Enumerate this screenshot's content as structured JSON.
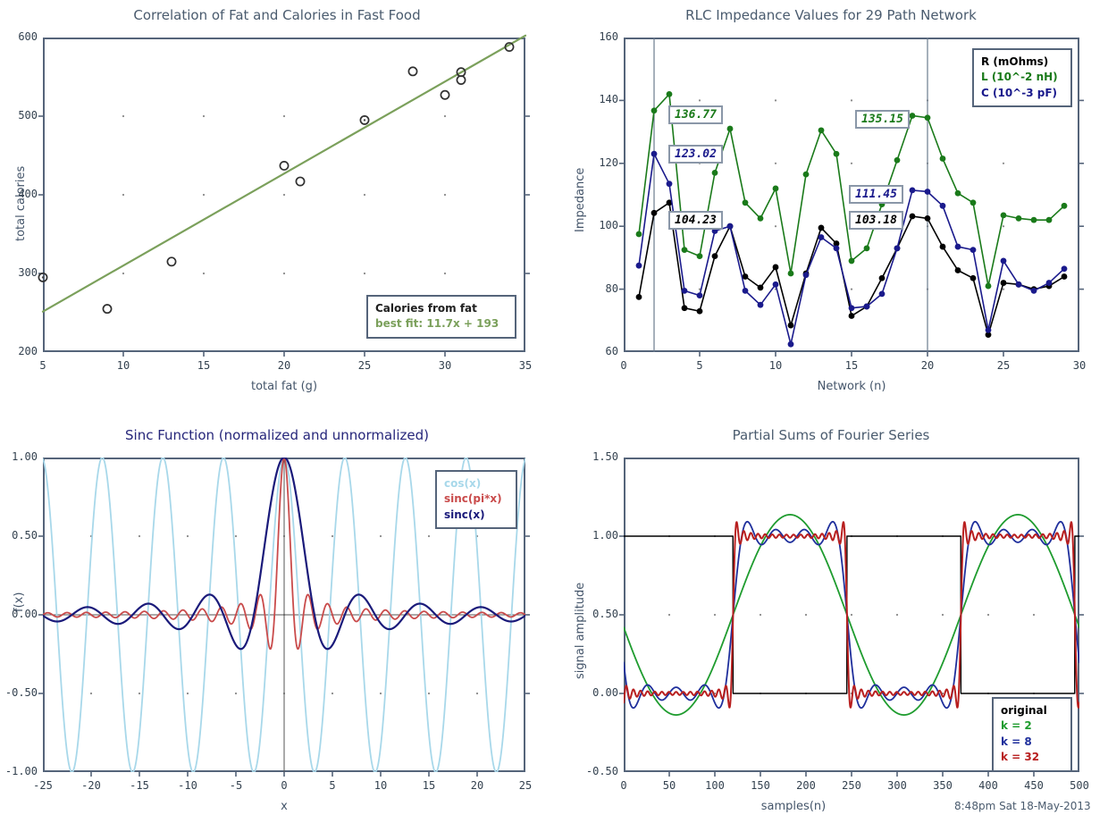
{
  "panels": {
    "scatter": {
      "title": "Correlation of Fat and Calories in Fast Food",
      "xlabel": "total fat (g)",
      "ylabel": "total calories",
      "legend": {
        "series_label": "Calories from fat",
        "fit_label": "best fit: 11.7x + 193"
      }
    },
    "rlc": {
      "title": "RLC Impedance Values for 29 Path Network",
      "xlabel": "Network (n)",
      "ylabel": "Impedance",
      "legend": {
        "r": "R (mOhms)",
        "l": "L (10^-2 nH)",
        "c": "C (10^-3 pF)"
      },
      "annotations": [
        "136.77",
        "123.02",
        "104.23",
        "135.15",
        "111.45",
        "103.18"
      ]
    },
    "sinc": {
      "title": "Sinc Function (normalized and unnormalized)",
      "xlabel": "x",
      "ylabel": "f(x)",
      "legend": {
        "cos": "cos(x)",
        "sincpi": "sinc(pi*x)",
        "sinc": "sinc(x)"
      }
    },
    "fourier": {
      "title": "Partial Sums of Fourier Series",
      "xlabel": "samples(n)",
      "ylabel": "signal amplitude",
      "legend": {
        "original": "original",
        "k2": "k = 2",
        "k8": "k = 8",
        "k32": "k = 32"
      },
      "timestamp": "8:48pm Sat 18-May-2013"
    }
  },
  "colors": {
    "frame": "#55647a",
    "title_slate": "#3f4a5a",
    "title_navy": "#26267a",
    "fit_green": "#7ba05b",
    "marker_black": "#303030",
    "series_r_black": "#000000",
    "series_l_green": "#1a7a1a",
    "series_c_blue": "#1a1a8c",
    "cos_lightblue": "#a8d8ea",
    "sinc_pi_red": "#c94b4b",
    "sinc_navy": "#1a1a7a",
    "fourier_green": "#1f9c2f",
    "fourier_blue": "#1f2f9c",
    "fourier_red": "#b81f1f",
    "fourier_black": "#000000"
  },
  "chart_data": [
    {
      "id": "scatter",
      "type": "scatter",
      "title": "Correlation of Fat and Calories in Fast Food",
      "xlabel": "total fat (g)",
      "ylabel": "total calories",
      "xlim": [
        5,
        35
      ],
      "ylim": [
        200,
        600
      ],
      "xticks": [
        5,
        10,
        15,
        20,
        25,
        30,
        35
      ],
      "yticks": [
        200,
        300,
        400,
        500,
        600
      ],
      "grid": "dotted-markers",
      "points": [
        {
          "x": 5,
          "y": 295
        },
        {
          "x": 9,
          "y": 255
        },
        {
          "x": 13,
          "y": 315
        },
        {
          "x": 20,
          "y": 437
        },
        {
          "x": 21,
          "y": 417
        },
        {
          "x": 25,
          "y": 495
        },
        {
          "x": 28,
          "y": 557
        },
        {
          "x": 30,
          "y": 527
        },
        {
          "x": 31,
          "y": 556
        },
        {
          "x": 31,
          "y": 546
        },
        {
          "x": 34,
          "y": 588
        }
      ],
      "fit": {
        "slope": 11.7,
        "intercept": 193,
        "label": "best fit: 11.7x + 193",
        "color": "#7ba05b"
      },
      "legend_entries": [
        "Calories from fat",
        "best fit: 11.7x + 193"
      ],
      "legend_position": "lower-right"
    },
    {
      "id": "rlc",
      "type": "line",
      "title": "RLC Impedance Values for 29 Path Network",
      "xlabel": "Network (n)",
      "ylabel": "Impedance",
      "xlim": [
        0,
        30
      ],
      "ylim": [
        60,
        160
      ],
      "xticks": [
        0,
        5,
        10,
        15,
        20,
        25,
        30
      ],
      "yticks": [
        60,
        80,
        100,
        120,
        140,
        160
      ],
      "x": [
        1,
        2,
        3,
        4,
        5,
        6,
        7,
        8,
        9,
        10,
        11,
        12,
        13,
        14,
        15,
        16,
        17,
        18,
        19,
        20,
        21,
        22,
        23,
        24,
        25,
        26,
        27,
        28,
        29
      ],
      "series": [
        {
          "name": "R (mOhms)",
          "color": "#000000",
          "values": [
            77.5,
            104.23,
            107.5,
            74.0,
            73.0,
            90.5,
            100.0,
            84.0,
            80.5,
            87.0,
            68.5,
            85.0,
            99.5,
            94.5,
            71.5,
            74.5,
            83.5,
            93.0,
            103.18,
            102.5,
            93.5,
            86.0,
            83.5,
            65.5,
            82.0,
            81.5,
            80.0,
            81.0,
            84.0
          ]
        },
        {
          "name": "L (10^-2 nH)",
          "color": "#1a7a1a",
          "values": [
            97.5,
            136.77,
            142.0,
            92.5,
            90.5,
            117.0,
            131.0,
            107.5,
            102.5,
            112.0,
            85.0,
            116.5,
            130.5,
            123.0,
            89.0,
            93.0,
            107.0,
            121.0,
            135.15,
            134.5,
            121.5,
            110.5,
            107.5,
            81.0,
            103.5,
            102.5,
            102.0,
            102.0,
            106.5
          ]
        },
        {
          "name": "C (10^-3 pF)",
          "color": "#1a1a8c",
          "values": [
            87.5,
            123.02,
            113.5,
            79.5,
            78.0,
            98.5,
            100.0,
            79.5,
            75.0,
            81.5,
            62.5,
            84.5,
            96.5,
            93.0,
            74.0,
            74.5,
            78.5,
            93.0,
            111.45,
            111.0,
            106.5,
            93.5,
            92.5,
            67.0,
            89.0,
            81.5,
            79.5,
            82.0,
            86.5
          ]
        }
      ],
      "vlines": [
        2,
        20
      ],
      "annotations": [
        {
          "text": "136.77",
          "x": 2,
          "y": 136.77,
          "color": "#1a7a1a"
        },
        {
          "text": "123.02",
          "x": 2,
          "y": 123.02,
          "color": "#1a1a8c"
        },
        {
          "text": "104.23",
          "x": 2,
          "y": 104.23,
          "color": "#000000"
        },
        {
          "text": "135.15",
          "x": 20,
          "y": 135.15,
          "color": "#1a7a1a"
        },
        {
          "text": "111.45",
          "x": 20,
          "y": 111.45,
          "color": "#1a1a8c"
        },
        {
          "text": "103.18",
          "x": 20,
          "y": 103.18,
          "color": "#000000"
        }
      ],
      "legend_entries": [
        "R (mOhms)",
        "L (10^-2 nH)",
        "C (10^-3 pF)"
      ],
      "legend_position": "upper-right"
    },
    {
      "id": "sinc",
      "type": "line",
      "title": "Sinc Function (normalized and unnormalized)",
      "xlabel": "x",
      "ylabel": "f(x)",
      "xlim": [
        -25,
        25
      ],
      "ylim": [
        -1.0,
        1.0
      ],
      "xticks": [
        -25,
        -20,
        -15,
        -10,
        -5,
        0,
        5,
        10,
        15,
        20,
        25
      ],
      "yticks": [
        -1.0,
        -0.5,
        0.0,
        0.5,
        1.0
      ],
      "series": [
        {
          "name": "cos(x)",
          "color": "#a8d8ea",
          "fn": "cos(x)"
        },
        {
          "name": "sinc(pi*x)",
          "color": "#c94b4b",
          "fn": "sin(pi*x)/(pi*x)"
        },
        {
          "name": "sinc(x)",
          "color": "#1a1a7a",
          "fn": "sin(x)/x"
        }
      ],
      "legend_entries": [
        "cos(x)",
        "sinc(pi*x)",
        "sinc(x)"
      ],
      "legend_position": "upper-right"
    },
    {
      "id": "fourier",
      "type": "line",
      "title": "Partial Sums of Fourier Series",
      "xlabel": "samples(n)",
      "ylabel": "signal amplitude",
      "xlim": [
        0,
        500
      ],
      "ylim": [
        -0.5,
        1.5
      ],
      "xticks": [
        0,
        50,
        100,
        150,
        200,
        250,
        300,
        350,
        400,
        450,
        500
      ],
      "yticks": [
        -0.5,
        0.0,
        0.5,
        1.0,
        1.5
      ],
      "square_wave": {
        "period": 250,
        "low": 0.0,
        "high": 1.0,
        "rise_at": 120,
        "fall_at": 248
      },
      "series": [
        {
          "name": "original",
          "color": "#000000",
          "harmonics": 0
        },
        {
          "name": "k = 2",
          "color": "#1f9c2f",
          "harmonics": 2
        },
        {
          "name": "k = 8",
          "color": "#1f2f9c",
          "harmonics": 8
        },
        {
          "name": "k = 32",
          "color": "#b81f1f",
          "harmonics": 32
        }
      ],
      "legend_entries": [
        "original",
        "k = 2",
        "k = 8",
        "k = 32"
      ],
      "legend_position": "lower-right",
      "timestamp": "8:48pm Sat 18-May-2013"
    }
  ]
}
